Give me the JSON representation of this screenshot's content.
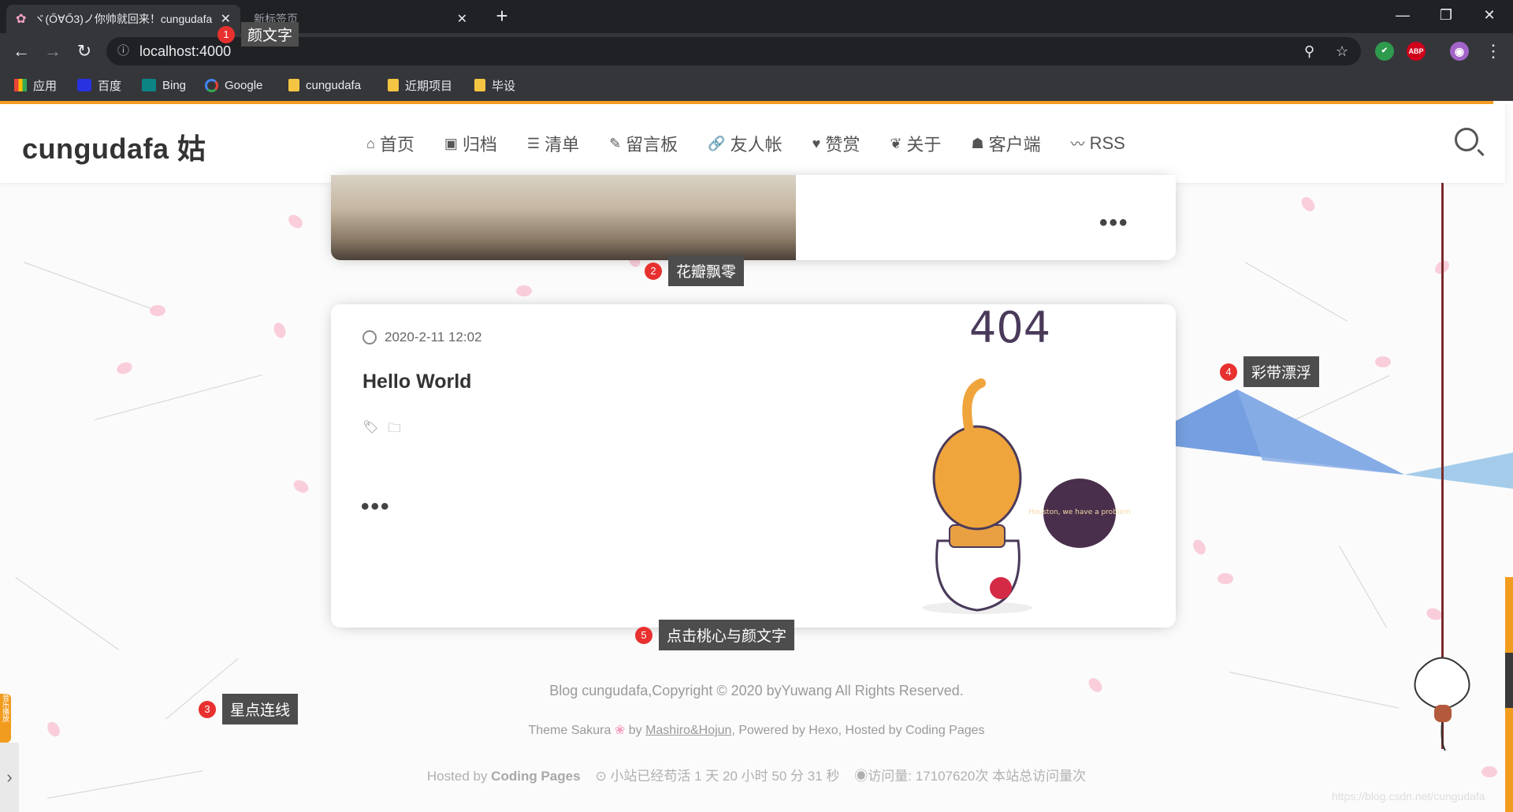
{
  "browser": {
    "tabs": [
      {
        "title": "ヾ(Ő∀Ő3)ノ你帅就回来！cungudafa",
        "close": "✕"
      },
      {
        "title": "新标签页",
        "close": "✕"
      }
    ],
    "new_tab": "+",
    "window": {
      "minimize": "—",
      "maximize": "❐",
      "close": "✕"
    },
    "nav": {
      "back": "←",
      "forward": "→",
      "reload": "↻"
    },
    "url": "localhost:4000",
    "info_icon": "ⓘ",
    "zoom_icon": "⚲",
    "star_icon": "☆",
    "extensions": [
      {
        "name": "shield-icon",
        "label": "✔",
        "color": "#2e9a4e"
      },
      {
        "name": "adblock-icon",
        "label": "ABP",
        "color": "#d0021b"
      },
      {
        "name": "profile-icon",
        "label": "◉",
        "color": "#a264c8"
      }
    ],
    "menu": "⋮",
    "bookmarks": [
      {
        "label": "应用",
        "icon": "apps-icon"
      },
      {
        "label": "百度",
        "icon": "baidu-icon"
      },
      {
        "label": "Bing",
        "icon": "bing-icon"
      },
      {
        "label": "Google",
        "icon": "google-icon"
      },
      {
        "label": "cungudafa",
        "icon": "folder-icon"
      },
      {
        "label": "近期项目",
        "icon": "folder-icon"
      },
      {
        "label": "毕设",
        "icon": "folder-icon"
      }
    ]
  },
  "site": {
    "logo": "cungudafa 姑",
    "nav": [
      {
        "label": "首页",
        "icon": "⌂"
      },
      {
        "label": "归档",
        "icon": "▣"
      },
      {
        "label": "清单",
        "icon": "☰"
      },
      {
        "label": "留言板",
        "icon": "✎"
      },
      {
        "label": "友人帐",
        "icon": "🔗"
      },
      {
        "label": "赞赏",
        "icon": "♥"
      },
      {
        "label": "关于",
        "icon": "❦"
      },
      {
        "label": "客户端",
        "icon": "☗"
      },
      {
        "label": "RSS",
        "icon": "〰"
      }
    ]
  },
  "post": {
    "more": "•••",
    "date": "2020-2-11 12:02",
    "title": "Hello World",
    "tag_icon": "🏷",
    "folder_icon": "🗀",
    "image_text": "404",
    "bubble": "Houston, we have a problem"
  },
  "footer": {
    "line1": "Blog cungudafa,Copyright © 2020 byYuwang All Rights Reserved.",
    "line2_prefix": "Theme Sakura",
    "line2_sakura": "❀",
    "line2_by": " by ",
    "line2_link": "Mashiro&Hojun",
    "line2_rest": ", Powered by Hexo, Hosted by Coding Pages",
    "hosted_prefix": "Hosted by ",
    "hosted_bold": "Coding Pages",
    "uptime": "⊙ 小站已经苟活 1 天 20 小时 50 分 31 秒",
    "visits": "◉访问量: 17107620次 本站总访问量次"
  },
  "side": {
    "left_badge": "音乐播放",
    "left_arrow": "›"
  },
  "watermark": "https://blog.csdn.net/cungudafa",
  "annotations": [
    {
      "num": "1",
      "label": "颜文字"
    },
    {
      "num": "2",
      "label": "花瓣飘零"
    },
    {
      "num": "3",
      "label": "星点连线"
    },
    {
      "num": "4",
      "label": "彩带漂浮"
    },
    {
      "num": "5",
      "label": "点击桃心与颜文字"
    }
  ]
}
